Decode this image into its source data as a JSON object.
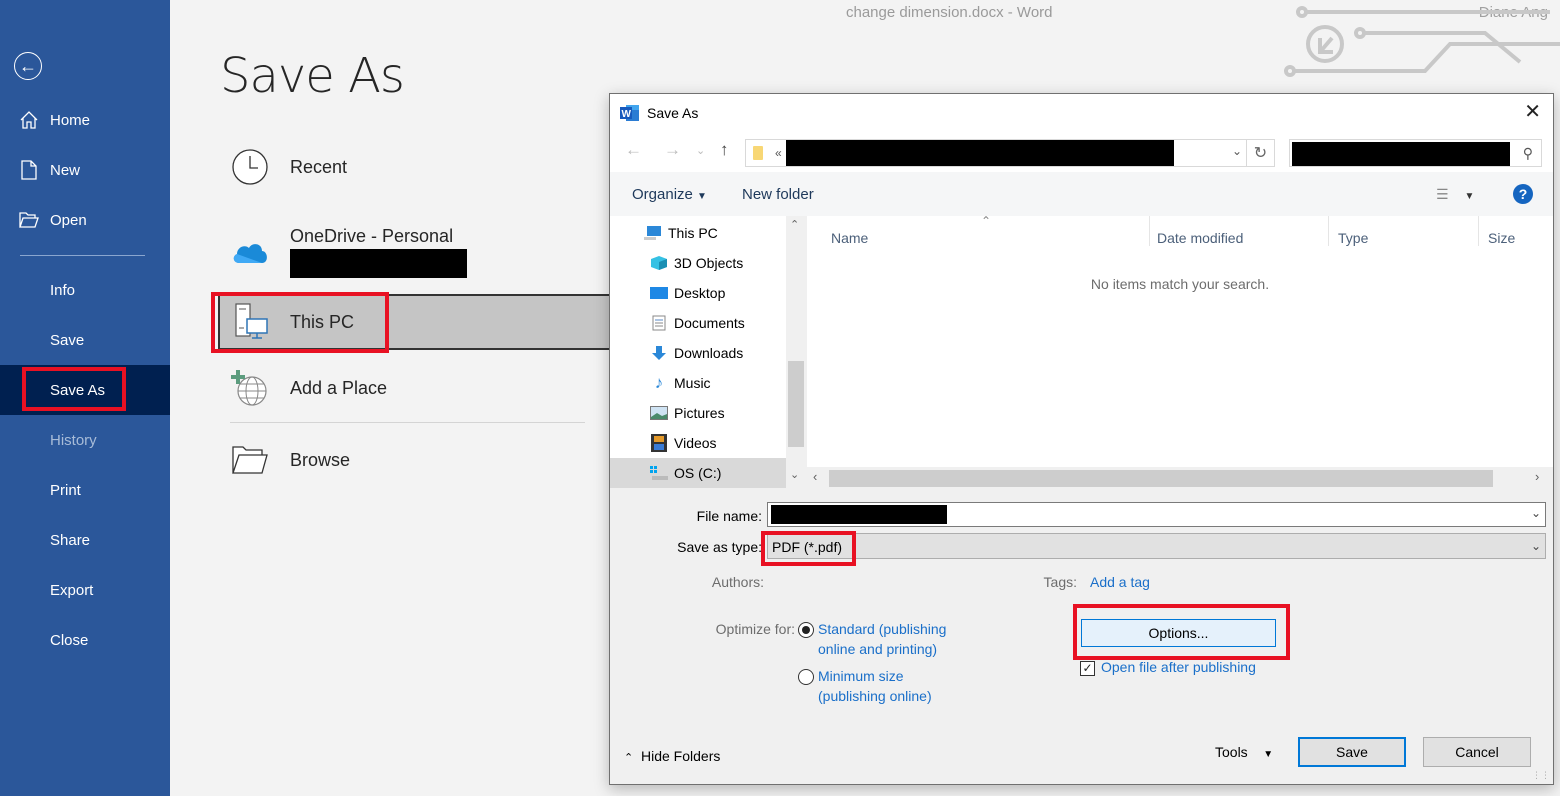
{
  "window": {
    "title": "change dimension.docx  -  Word",
    "user": "Diane Ang"
  },
  "sidebar": {
    "back_icon": "back-arrow-circle-icon",
    "items": [
      {
        "label": "Home",
        "icon": "home-icon",
        "state": "normal"
      },
      {
        "label": "New",
        "icon": "new-document-icon",
        "state": "normal"
      },
      {
        "label": "Open",
        "icon": "open-folder-icon",
        "state": "normal"
      },
      {
        "label": "Info",
        "state": "normal"
      },
      {
        "label": "Save",
        "state": "normal"
      },
      {
        "label": "Save As",
        "state": "active"
      },
      {
        "label": "History",
        "state": "disabled"
      },
      {
        "label": "Print",
        "state": "normal"
      },
      {
        "label": "Share",
        "state": "normal"
      },
      {
        "label": "Export",
        "state": "normal"
      },
      {
        "label": "Close",
        "state": "normal"
      }
    ]
  },
  "backstage": {
    "page_title": "Save As",
    "places": [
      {
        "label": "Recent",
        "icon": "clock-icon"
      },
      {
        "label": "OneDrive - Personal",
        "icon": "onedrive-cloud-icon",
        "sublabel": "[redacted]"
      },
      {
        "label": "This PC",
        "icon": "this-pc-icon",
        "selected": true
      },
      {
        "label": "Add a Place",
        "icon": "add-place-globe-icon"
      },
      {
        "label": "Browse",
        "icon": "browse-folder-icon"
      }
    ]
  },
  "dialog": {
    "title": "Save As",
    "address_path": "[redacted]",
    "address_prefix": "«",
    "search_value": "[redacted]",
    "toolbar": {
      "organize": "Organize",
      "new_folder": "New folder"
    },
    "nav_tree": [
      {
        "label": "This PC",
        "icon": "this-pc-icon"
      },
      {
        "label": "3D Objects",
        "icon": "3d-objects-icon"
      },
      {
        "label": "Desktop",
        "icon": "desktop-icon"
      },
      {
        "label": "Documents",
        "icon": "documents-icon"
      },
      {
        "label": "Downloads",
        "icon": "downloads-icon"
      },
      {
        "label": "Music",
        "icon": "music-icon"
      },
      {
        "label": "Pictures",
        "icon": "pictures-icon"
      },
      {
        "label": "Videos",
        "icon": "videos-icon"
      },
      {
        "label": "OS (C:)",
        "icon": "drive-icon",
        "selected": true
      }
    ],
    "columns": [
      "Name",
      "Date modified",
      "Type",
      "Size"
    ],
    "empty_message": "No items match your search.",
    "form": {
      "file_name_label": "File name:",
      "file_name_value": "[redacted]",
      "save_type_label": "Save as type:",
      "save_type_value": "PDF (*.pdf)",
      "authors_label": "Authors:",
      "tags_label": "Tags:",
      "tags_link": "Add a tag",
      "optimize_label": "Optimize for:",
      "optimize_options": [
        {
          "line1": "Standard (publishing",
          "line2": "online and printing)",
          "checked": true
        },
        {
          "line1": "Minimum size",
          "line2": "(publishing online)",
          "checked": false
        }
      ],
      "options_button": "Options...",
      "open_after_label": "Open file after publishing",
      "open_after_checked": true
    },
    "footer": {
      "hide_folders": "Hide Folders",
      "tools": "Tools",
      "save": "Save",
      "cancel": "Cancel"
    }
  },
  "colors": {
    "sidebar_bg": "#2b579a",
    "sidebar_active": "#002050",
    "highlight_red": "#e81123",
    "link_blue": "#1a6fc9",
    "focus_blue": "#0078d7"
  }
}
